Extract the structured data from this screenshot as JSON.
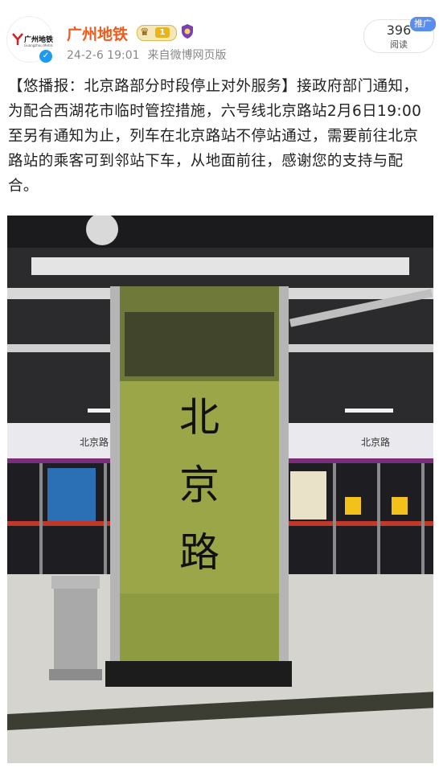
{
  "post": {
    "account_name": "广州地铁",
    "level_badge": "1",
    "time": "24-2-6 19:01",
    "source": "来自微博网页版",
    "read_count": "396",
    "read_label": "阅读",
    "promo_tag": "推广",
    "text": "【悠播报：北京路部分时段停止对外服务】接政府部门通知，为配合西湖花市临时管控措施，六号线北京路站2月6日19:00至另有通知为止，列车在北京路站不停站通过，需要前往北京路站的乘客可到邻站下车，从地面前往，感谢您的支持与配合。"
  },
  "avatar": {
    "logo_text": "广州地铁",
    "logo_sub": "Guangzhou Metro"
  },
  "photo": {
    "pillar_chars": [
      "北",
      "京",
      "路"
    ],
    "sign_text_left": "北京路",
    "sign_text_right": "北京路"
  },
  "colors": {
    "name_orange": "#f05a1a",
    "verified_blue": "#1d9bf0",
    "pillar_green": "#9aa648",
    "platform_purple": "#7a2e7a"
  }
}
